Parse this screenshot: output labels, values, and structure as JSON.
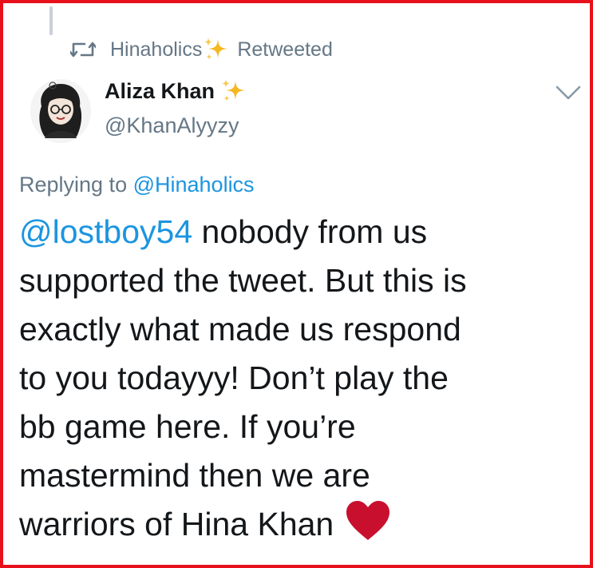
{
  "retweet": {
    "user": "Hinaholics",
    "suffix": "Retweeted",
    "icon": "retweet-icon"
  },
  "author": {
    "display_name": "Aliza Khan",
    "handle": "@KhanAlyyzy",
    "emoji": "sparkles-icon"
  },
  "reply": {
    "prefix": "Replying to ",
    "mention": "@Hinaholics"
  },
  "tweet": {
    "mention": "@lostboy54",
    "line1_rest": " nobody from us",
    "line2": "supported the tweet. But this is",
    "line3": "exactly what made us respond",
    "line4": "to you todayyy! Don’t play the",
    "line5": "bb game here. If you’re",
    "line6": "mastermind then we are",
    "line7": "warriors of Hina Khan",
    "end_emoji": "red-heart-icon"
  },
  "colors": {
    "frame_border": "#e8101a",
    "mention_blue": "#1b95e0",
    "secondary_gray": "#657786",
    "text_black": "#14171a",
    "heart_red": "#c8102e",
    "sparkle_gold": "#f5b820"
  }
}
